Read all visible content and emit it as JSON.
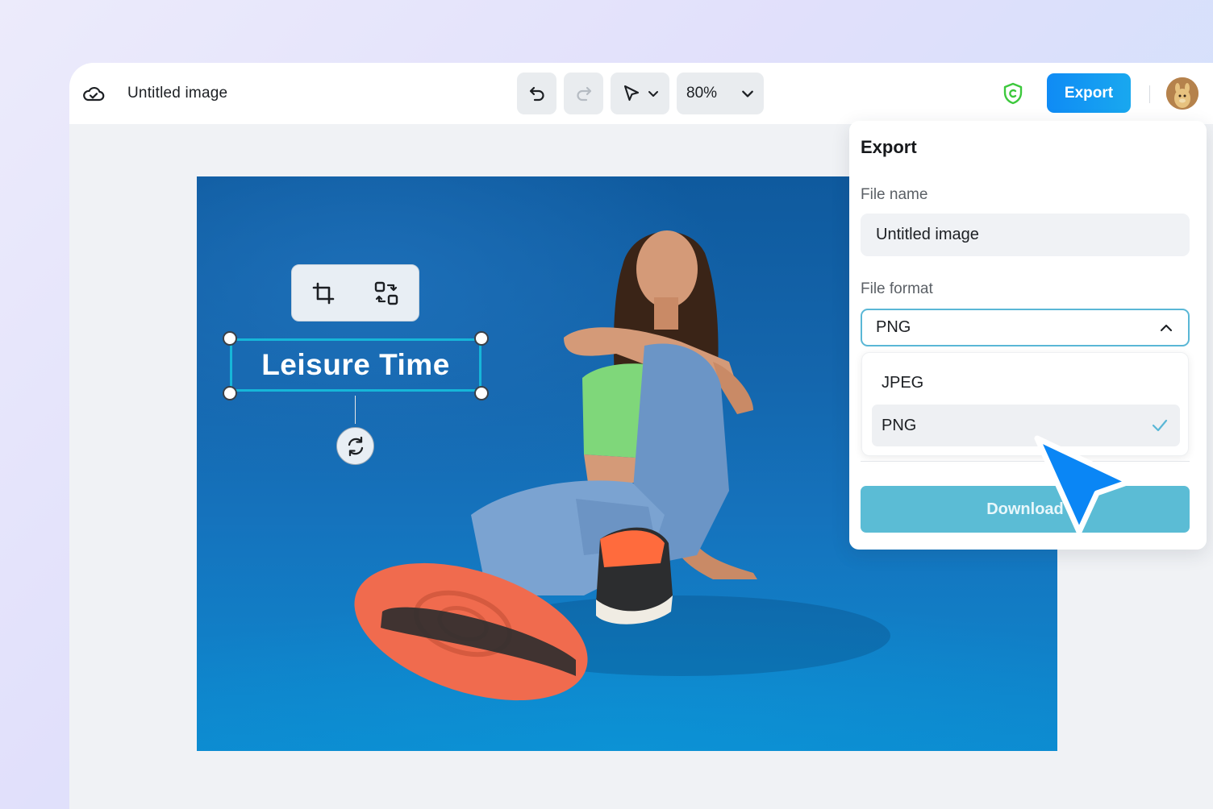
{
  "header": {
    "doc_title": "Untitled image",
    "zoom": "80%",
    "export_label": "Export"
  },
  "canvas": {
    "text_layer": "Leisure Time"
  },
  "export_panel": {
    "title": "Export",
    "file_name_label": "File name",
    "file_name_value": "Untitled image",
    "file_format_label": "File format",
    "selected_format": "PNG",
    "options": [
      {
        "label": "JPEG",
        "selected": false
      },
      {
        "label": "PNG",
        "selected": true
      }
    ],
    "download_label": "Download"
  },
  "icons": [
    "cloud-icon",
    "undo-icon",
    "redo-icon",
    "pointer-icon",
    "chevron-down-icon",
    "shield-icon",
    "avatar",
    "crop-icon",
    "replace-icon",
    "rotate-icon",
    "chevron-up-icon",
    "check-icon",
    "cursor-arrow-icon"
  ],
  "colors": {
    "accent": "#16b6d8",
    "export_button": "#0f8bf5",
    "download_button": "#5bbcd5",
    "shield": "#3cc83c"
  }
}
